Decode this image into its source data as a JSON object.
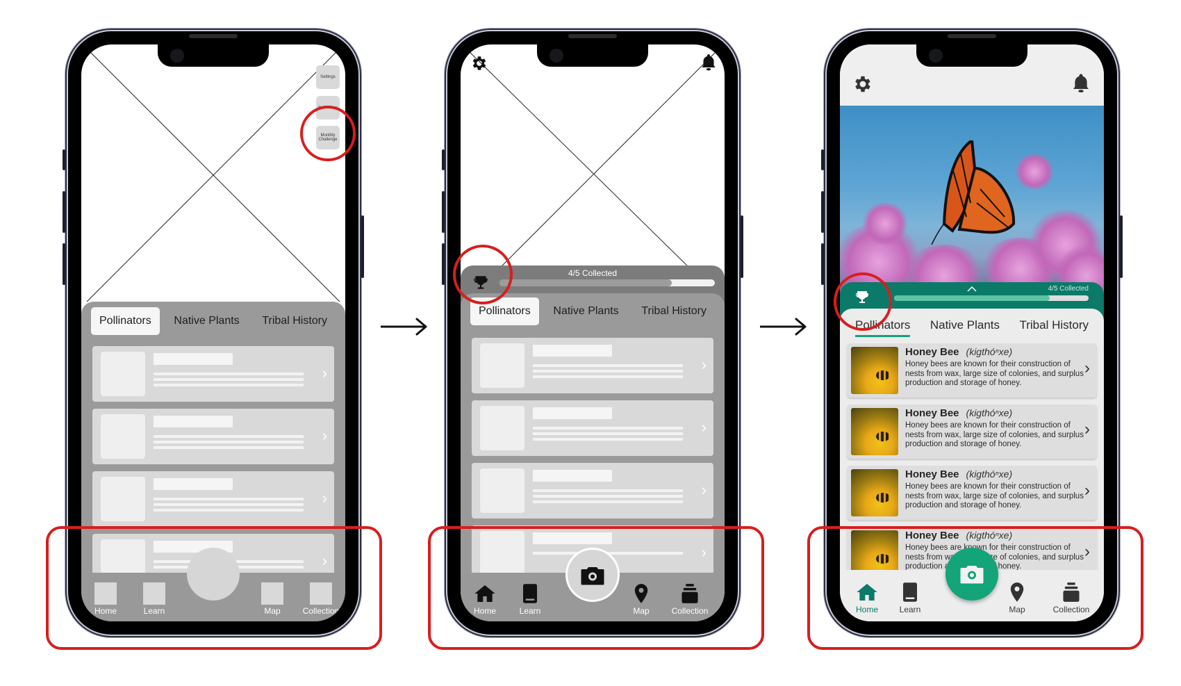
{
  "arrows": [
    "arrow-right",
    "arrow-right"
  ],
  "annotation_color": "#d81e1e",
  "phone1": {
    "side_buttons": [
      "Settings",
      "Notifications",
      "Monthly Challenge"
    ],
    "tabs": [
      "Pollinators",
      "Native Plants",
      "Tribal History"
    ],
    "active_tab": "Pollinators",
    "placeholder_cards": 4,
    "nav": [
      "Home",
      "Learn",
      "Map",
      "Collection"
    ]
  },
  "phone2": {
    "icons": {
      "settings": "gear-icon",
      "notifications": "bell-icon",
      "challenge": "trophy-icon",
      "camera": "camera-icon"
    },
    "progress_label": "4/5 Collected",
    "progress_fraction": 0.8,
    "tabs": [
      "Pollinators",
      "Native Plants",
      "Tribal History"
    ],
    "active_tab": "Pollinators",
    "placeholder_cards": 4,
    "nav": [
      "Home",
      "Learn",
      "Map",
      "Collection"
    ]
  },
  "phone3": {
    "icons": {
      "settings": "gear-icon",
      "notifications": "bell-icon",
      "challenge": "trophy-icon",
      "expand": "chevron-up-icon",
      "camera": "camera-icon"
    },
    "hero_image": "monarch butterfly on purple flowers",
    "progress_label": "4/5 Collected",
    "progress_fraction": 0.8,
    "tabs": [
      "Pollinators",
      "Native Plants",
      "Tribal History"
    ],
    "active_tab": "Pollinators",
    "accent_color": "#13a479",
    "sheet_color": "#0b7a68",
    "cards": [
      {
        "name": "Honey Bee",
        "native_name": "(kigthóⁿxe)",
        "description": "Honey bees are known for their construction of nests from wax, large size of colonies, and surplus production and storage of honey."
      },
      {
        "name": "Honey Bee",
        "native_name": "(kigthóⁿxe)",
        "description": "Honey bees are known for their construction of nests from wax, large size of colonies, and surplus production and storage of honey."
      },
      {
        "name": "Honey Bee",
        "native_name": "(kigthóⁿxe)",
        "description": "Honey bees are known for their construction of nests from wax, large size of colonies, and surplus production and storage of honey."
      },
      {
        "name": "Honey Bee",
        "native_name": "(kigthóⁿxe)",
        "description": "Honey bees are known for their construction of nests from wax, large size of colonies, and surplus production and storage of honey."
      }
    ],
    "nav": [
      "Home",
      "Learn",
      "Map",
      "Collection"
    ],
    "active_nav": "Home"
  }
}
